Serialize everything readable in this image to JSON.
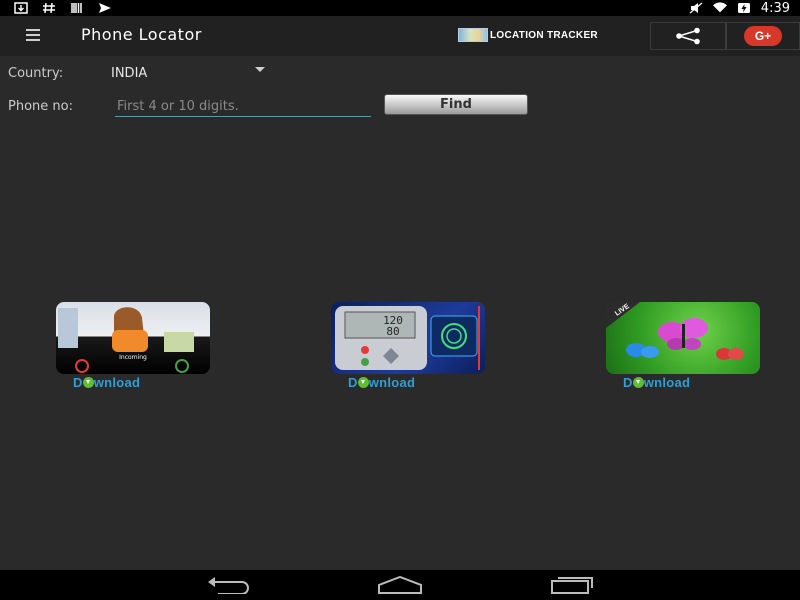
{
  "status_bar": {
    "time": "4:39",
    "left_icons": [
      "download-icon",
      "hash-icon",
      "barcode-icon",
      "paper-plane-icon"
    ],
    "right_icons": [
      "mute-icon",
      "wifi-icon",
      "battery-charging-icon"
    ]
  },
  "app_bar": {
    "title": "Phone Locator",
    "location_tracker_label": "LOCATION TRACKER",
    "share_icon": "share-icon",
    "gplus_label": "G+"
  },
  "form": {
    "country_label": "Country:",
    "country_value": "INDIA",
    "phone_label": "Phone no:",
    "phone_placeholder": "First 4 or 10 digits.",
    "phone_value": "",
    "find_label": "Find"
  },
  "promos": [
    {
      "name": "caller-app",
      "download_label_pre": "D",
      "download_label_post": "wnload"
    },
    {
      "name": "blood-pressure-app",
      "download_label_pre": "D",
      "download_label_post": "wnload"
    },
    {
      "name": "butterfly-live-wallpaper",
      "download_label_pre": "D",
      "download_label_post": "wnload",
      "badge": "LIVE"
    }
  ],
  "nav_bar": {
    "icons": [
      "back-icon",
      "home-icon",
      "recents-icon"
    ]
  },
  "colors": {
    "background": "#2a2a2a",
    "app_bar": "#212121",
    "download_text": "#2e9fd3",
    "gplus": "#d7382a",
    "input_underline": "#5e9aa6"
  }
}
